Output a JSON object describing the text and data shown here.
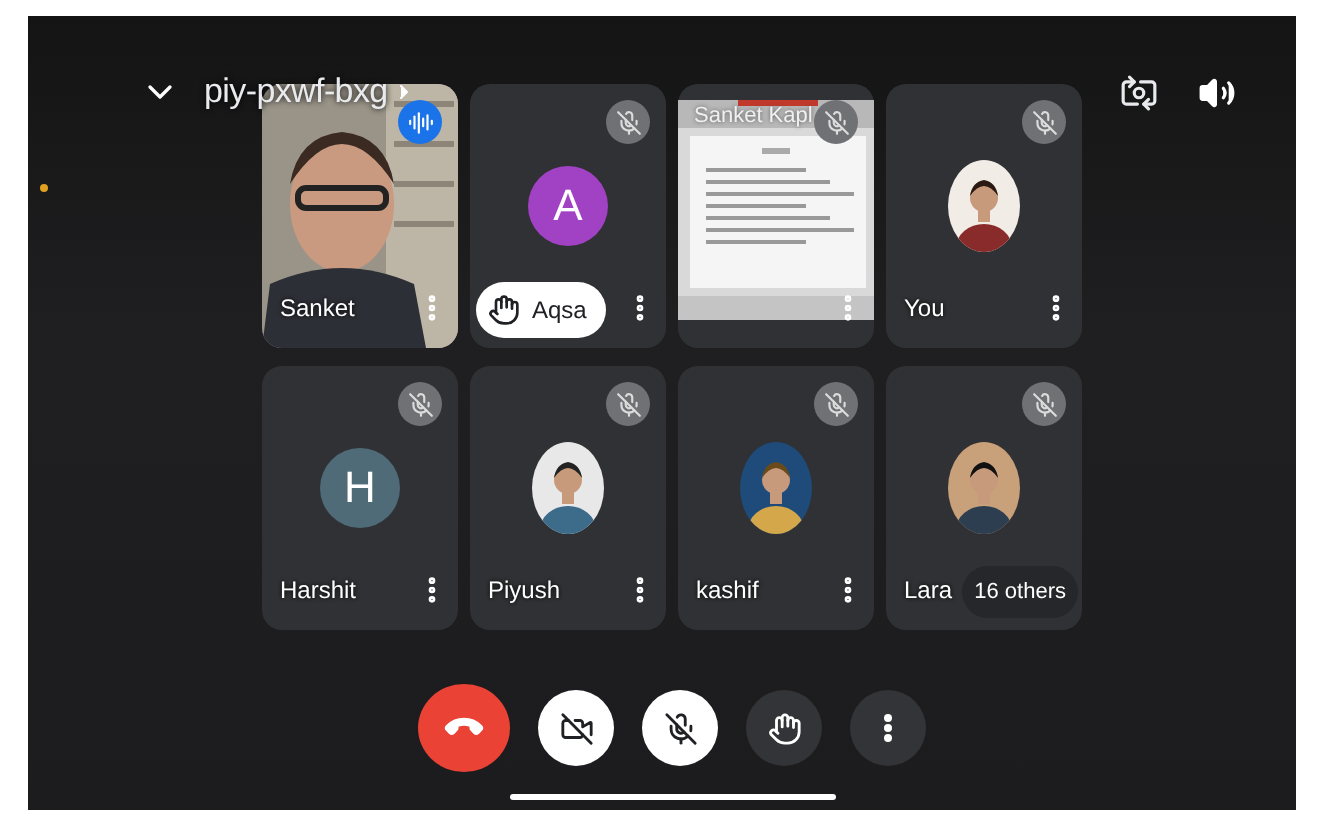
{
  "header": {
    "meeting_code": "piy-pxwf-bxg"
  },
  "tiles": [
    {
      "kind": "video",
      "name": "Sanket",
      "speaking": true,
      "muted": false,
      "hand_raised": false
    },
    {
      "kind": "letter",
      "name": "Aqsa",
      "letter": "A",
      "color": "#a142c4",
      "muted": true,
      "hand_raised": true
    },
    {
      "kind": "screen",
      "caption": "Sanket Kapl",
      "muted": true,
      "hand_raised": false
    },
    {
      "name": "You",
      "muted": true,
      "hand_raised": false
    },
    {
      "kind": "letter",
      "name": "Harshit",
      "letter": "H",
      "color": "#4f6b78",
      "muted": true,
      "hand_raised": false
    },
    {
      "name": "Piyush",
      "muted": true,
      "hand_raised": false
    },
    {
      "name": "kashif",
      "muted": true,
      "hand_raised": false
    },
    {
      "name": "Lara",
      "others": "16 others",
      "muted": true,
      "hand_raised": false
    }
  ],
  "controls": [
    {
      "kind": "hangup"
    },
    {
      "kind": "camera",
      "on": false
    },
    {
      "kind": "mic",
      "on": false
    },
    {
      "kind": "hand",
      "on": false
    },
    {
      "kind": "more"
    }
  ]
}
